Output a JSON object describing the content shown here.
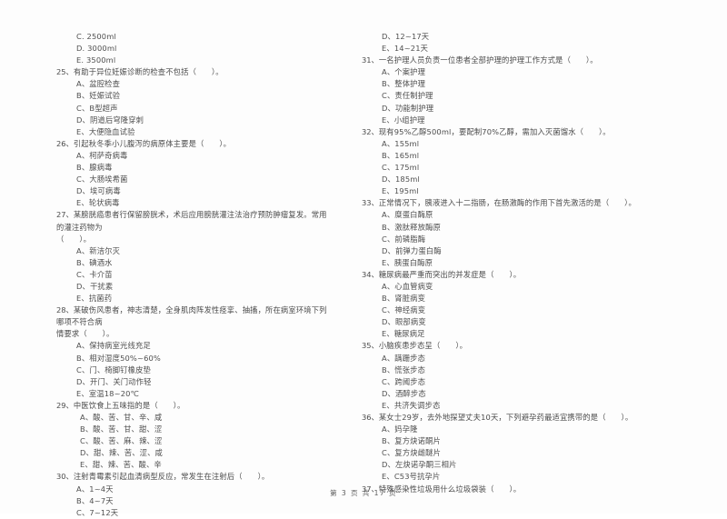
{
  "document": {
    "page_footer": "第 3 页 共 17 页",
    "page_number": "3",
    "total_pages": "17"
  },
  "left_column": {
    "orphan_options": [
      "C. 2500ml",
      "D. 3000ml",
      "E. 3500ml"
    ],
    "questions": [
      {
        "number": "25、",
        "stem": "有助于异位妊娠诊断的检查不包括（　　）。",
        "options": [
          "A、盆腔检查",
          "B、妊娠试验",
          "C、B型超声",
          "D、阴道后穹隆穿刺",
          "E、大便隐血试验"
        ]
      },
      {
        "number": "26、",
        "stem": "引起秋冬季小儿腹泻的病原体主要是（　　）。",
        "options": [
          "A、柯萨奇病毒",
          "B、腺病毒",
          "C、大肠埃希菌",
          "D、埃可病毒",
          "E、轮状病毒"
        ]
      },
      {
        "number": "27、",
        "stem": "某膀胱癌患者行保留膀胱术，术后应用膀胱灌注法治疗预防肿瘤复发。常用的灌注药物为",
        "stem_cont": "（　　）。",
        "options": [
          "A、新洁尔灭",
          "B、碘酒水",
          "C、卡介苗",
          "D、干扰素",
          "E、抗菌药"
        ]
      },
      {
        "number": "28、",
        "stem": "某破伤风患者，神志清楚，全身肌肉阵发性痉挛、抽搐，所在病室环境下列哪项不符合病",
        "stem_cont": "情要求（　　）。",
        "options": [
          "A、保持病室光线充足",
          "B、相对湿度50%~60%",
          "C、门、椅脚钉橡皮垫",
          "D、开门、关门动作轻",
          "E、室温18~20℃"
        ]
      },
      {
        "number": "29、",
        "stem": "中医饮食上五味指的是（　　）。",
        "options": [
          "A、酸、苦、甘、辛、咸",
          "B、酸、苦、甘、甜、涩",
          "C、酸、苦、麻、辣、涩",
          "D、甜、辣、苦、涩、咸",
          "E、甜、辣、苦、酸、辛"
        ]
      },
      {
        "number": "30、",
        "stem": "注射青霉素引起血清病型反应，常发生在注射后（　　）。",
        "options": [
          "A、1~4天",
          "B、4~7天",
          "C、7~12天"
        ]
      }
    ]
  },
  "right_column": {
    "orphan_options": [
      "D、12~17天",
      "E、14~21天"
    ],
    "questions": [
      {
        "number": "31、",
        "stem": "一名护理人员负责一位患者全部护理的护理工作方式是（　　）。",
        "options": [
          "A、个案护理",
          "B、整体护理",
          "C、责任制护理",
          "D、功能制护理",
          "E、小组护理"
        ]
      },
      {
        "number": "32、",
        "stem": "现有95%乙醇500ml，要配制70%乙醇，需加入灭菌馏水（　　）。",
        "options": [
          "A、155ml",
          "B、165ml",
          "C、175ml",
          "D、185ml",
          "E、195ml"
        ]
      },
      {
        "number": "33、",
        "stem": "正常情况下，胰液进入十二指肠，在肠激酶的作用下首先激活的是（　　）。",
        "options": [
          "A、糜蛋白酶原",
          "B、激肽释放酶原",
          "C、前磷脂酶",
          "D、前弹力蛋白酶",
          "E、胰蛋白酶原"
        ]
      },
      {
        "number": "34、",
        "stem": "糖尿病最严重而突出的并发症是（　　）。",
        "options": [
          "A、心血管病变",
          "B、肾脏病变",
          "C、神经病变",
          "D、眼部病变",
          "E、糖尿病足"
        ]
      },
      {
        "number": "35、",
        "stem": "小脑疾患步态呈（　　）。",
        "options": [
          "A、蹒跚步态",
          "B、慌张步态",
          "C、跨阈步态",
          "D、酒醉步态",
          "E、共济失调步态"
        ]
      },
      {
        "number": "36、",
        "stem": "某女士29岁，去外地探望丈夫10天，下列避孕药最适宜携带的是（　　）。",
        "options": [
          "A、妈孕隆",
          "B、复方炔诺酮片",
          "C、复方炔雌醚片",
          "D、左炔诺孕酮三相片",
          "E、C53号抗孕片"
        ]
      },
      {
        "number": "37、",
        "stem": "特殊感染性垃圾用什么垃圾袋装（　　）。",
        "options": []
      }
    ]
  }
}
